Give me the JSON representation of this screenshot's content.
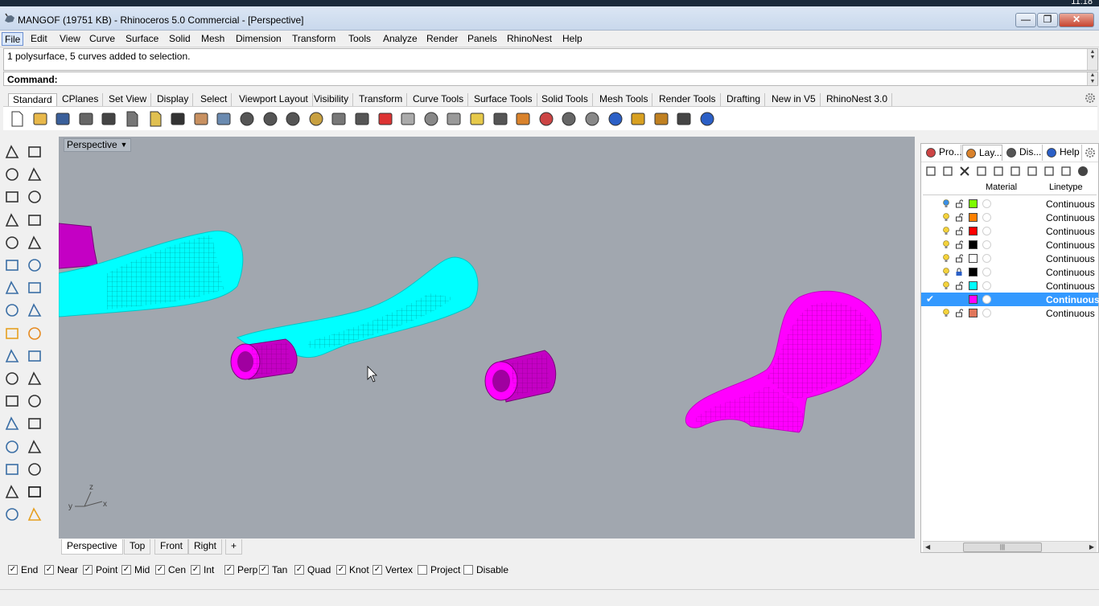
{
  "title_bar": {
    "title": "MANGOF (19751 KB) - Rhinoceros 5.0 Commercial - [Perspective]",
    "minimize": "—",
    "maximize": "❐",
    "close": "✕"
  },
  "system_tray": {
    "time": "11:18"
  },
  "menu": [
    {
      "label": "File",
      "active": true
    },
    {
      "label": "Edit"
    },
    {
      "label": "View"
    },
    {
      "label": "Curve"
    },
    {
      "label": "Surface"
    },
    {
      "label": "Solid"
    },
    {
      "label": "Mesh"
    },
    {
      "label": "Dimension"
    },
    {
      "label": "Transform"
    },
    {
      "label": "Tools"
    },
    {
      "label": "Analyze"
    },
    {
      "label": "Render"
    },
    {
      "label": "Panels"
    },
    {
      "label": "RhinoNest"
    },
    {
      "label": "Help"
    }
  ],
  "command": {
    "history_line": "1 polysurface, 5 curves added to selection.",
    "prompt_label": "Command:"
  },
  "toolbar_tabs": [
    {
      "label": "Standard",
      "active": true
    },
    {
      "label": "CPlanes"
    },
    {
      "label": "Set View"
    },
    {
      "label": "Display"
    },
    {
      "label": "Select"
    },
    {
      "label": "Viewport Layout"
    },
    {
      "label": "Visibility"
    },
    {
      "label": "Transform"
    },
    {
      "label": "Curve Tools"
    },
    {
      "label": "Surface Tools"
    },
    {
      "label": "Solid Tools"
    },
    {
      "label": "Mesh Tools"
    },
    {
      "label": "Render Tools"
    },
    {
      "label": "Drafting"
    },
    {
      "label": "New in V5"
    },
    {
      "label": "RhinoNest 3.0"
    }
  ],
  "toolbar_icons": [
    "new-file-icon",
    "open-file-icon",
    "save-icon",
    "print-icon",
    "cut-icon",
    "copy-icon",
    "paste-icon",
    "undo-icon",
    "pan-icon",
    "rotate-view-icon",
    "zoom-icon",
    "zoom-window-icon",
    "zoom-extents-icon",
    "zoom-selected-icon",
    "rotate-camera-icon",
    "four-viewports-icon",
    "car-icon",
    "cplane-icon",
    "circle-dot-icon",
    "point-icon",
    "light-bulb-icon",
    "lock-icon",
    "layer-icon",
    "color-wheel-icon",
    "shaded-sphere-icon",
    "rendered-sphere-icon",
    "blue-sphere-icon",
    "dimension-icon",
    "gear-settings-icon",
    "snap-icon",
    "help-icon"
  ],
  "viewport": {
    "label": "Perspective",
    "axis_labels": {
      "z": "z",
      "x": "x",
      "y": "y"
    },
    "colors": {
      "background": "#a1a7af",
      "cyan": "#00ffff",
      "magenta": "#ff00ff",
      "dark_magenta": "#c400c4"
    }
  },
  "viewport_tabs": [
    {
      "label": "Perspective",
      "active": true
    },
    {
      "label": "Top"
    },
    {
      "label": "Front"
    },
    {
      "label": "Right"
    },
    {
      "label": "+"
    }
  ],
  "right_panel": {
    "tabs": [
      {
        "label": "Pro...",
        "icon": "properties-icon"
      },
      {
        "label": "Lay...",
        "icon": "layers-icon",
        "active": true
      },
      {
        "label": "Dis...",
        "icon": "display-icon"
      },
      {
        "label": "Help",
        "icon": "help-panel-icon"
      }
    ],
    "columns": {
      "material": "Material",
      "linetype": "Linetype"
    },
    "layers": [
      {
        "color": "#7cfc00",
        "linetype": "Continuous",
        "current": false,
        "bulb": "blue"
      },
      {
        "color": "#ff8000",
        "linetype": "Continuous",
        "current": false
      },
      {
        "color": "#ff0000",
        "linetype": "Continuous",
        "current": false
      },
      {
        "color": "#000000",
        "linetype": "Continuous",
        "current": false
      },
      {
        "color": "#ffffff",
        "linetype": "Continuous",
        "current": false
      },
      {
        "color": "#000000",
        "linetype": "Continuous",
        "current": false,
        "locked": true
      },
      {
        "color": "#00ffff",
        "linetype": "Continuous",
        "current": false
      },
      {
        "color": "#ff00ff",
        "linetype": "Continuous",
        "current": true
      },
      {
        "color": "#e0765a",
        "linetype": "Continuous",
        "current": false
      }
    ]
  },
  "osnaps": [
    {
      "label": "End",
      "checked": true
    },
    {
      "label": "Near",
      "checked": true
    },
    {
      "label": "Point",
      "checked": true
    },
    {
      "label": "Mid",
      "checked": true
    },
    {
      "label": "Cen",
      "checked": true
    },
    {
      "label": "Int",
      "checked": true
    },
    {
      "label": "Perp",
      "checked": true
    },
    {
      "label": "Tan",
      "checked": true
    },
    {
      "label": "Quad",
      "checked": true
    },
    {
      "label": "Knot",
      "checked": true
    },
    {
      "label": "Vertex",
      "checked": true
    },
    {
      "label": "Project",
      "checked": false
    },
    {
      "label": "Disable",
      "checked": false
    }
  ]
}
